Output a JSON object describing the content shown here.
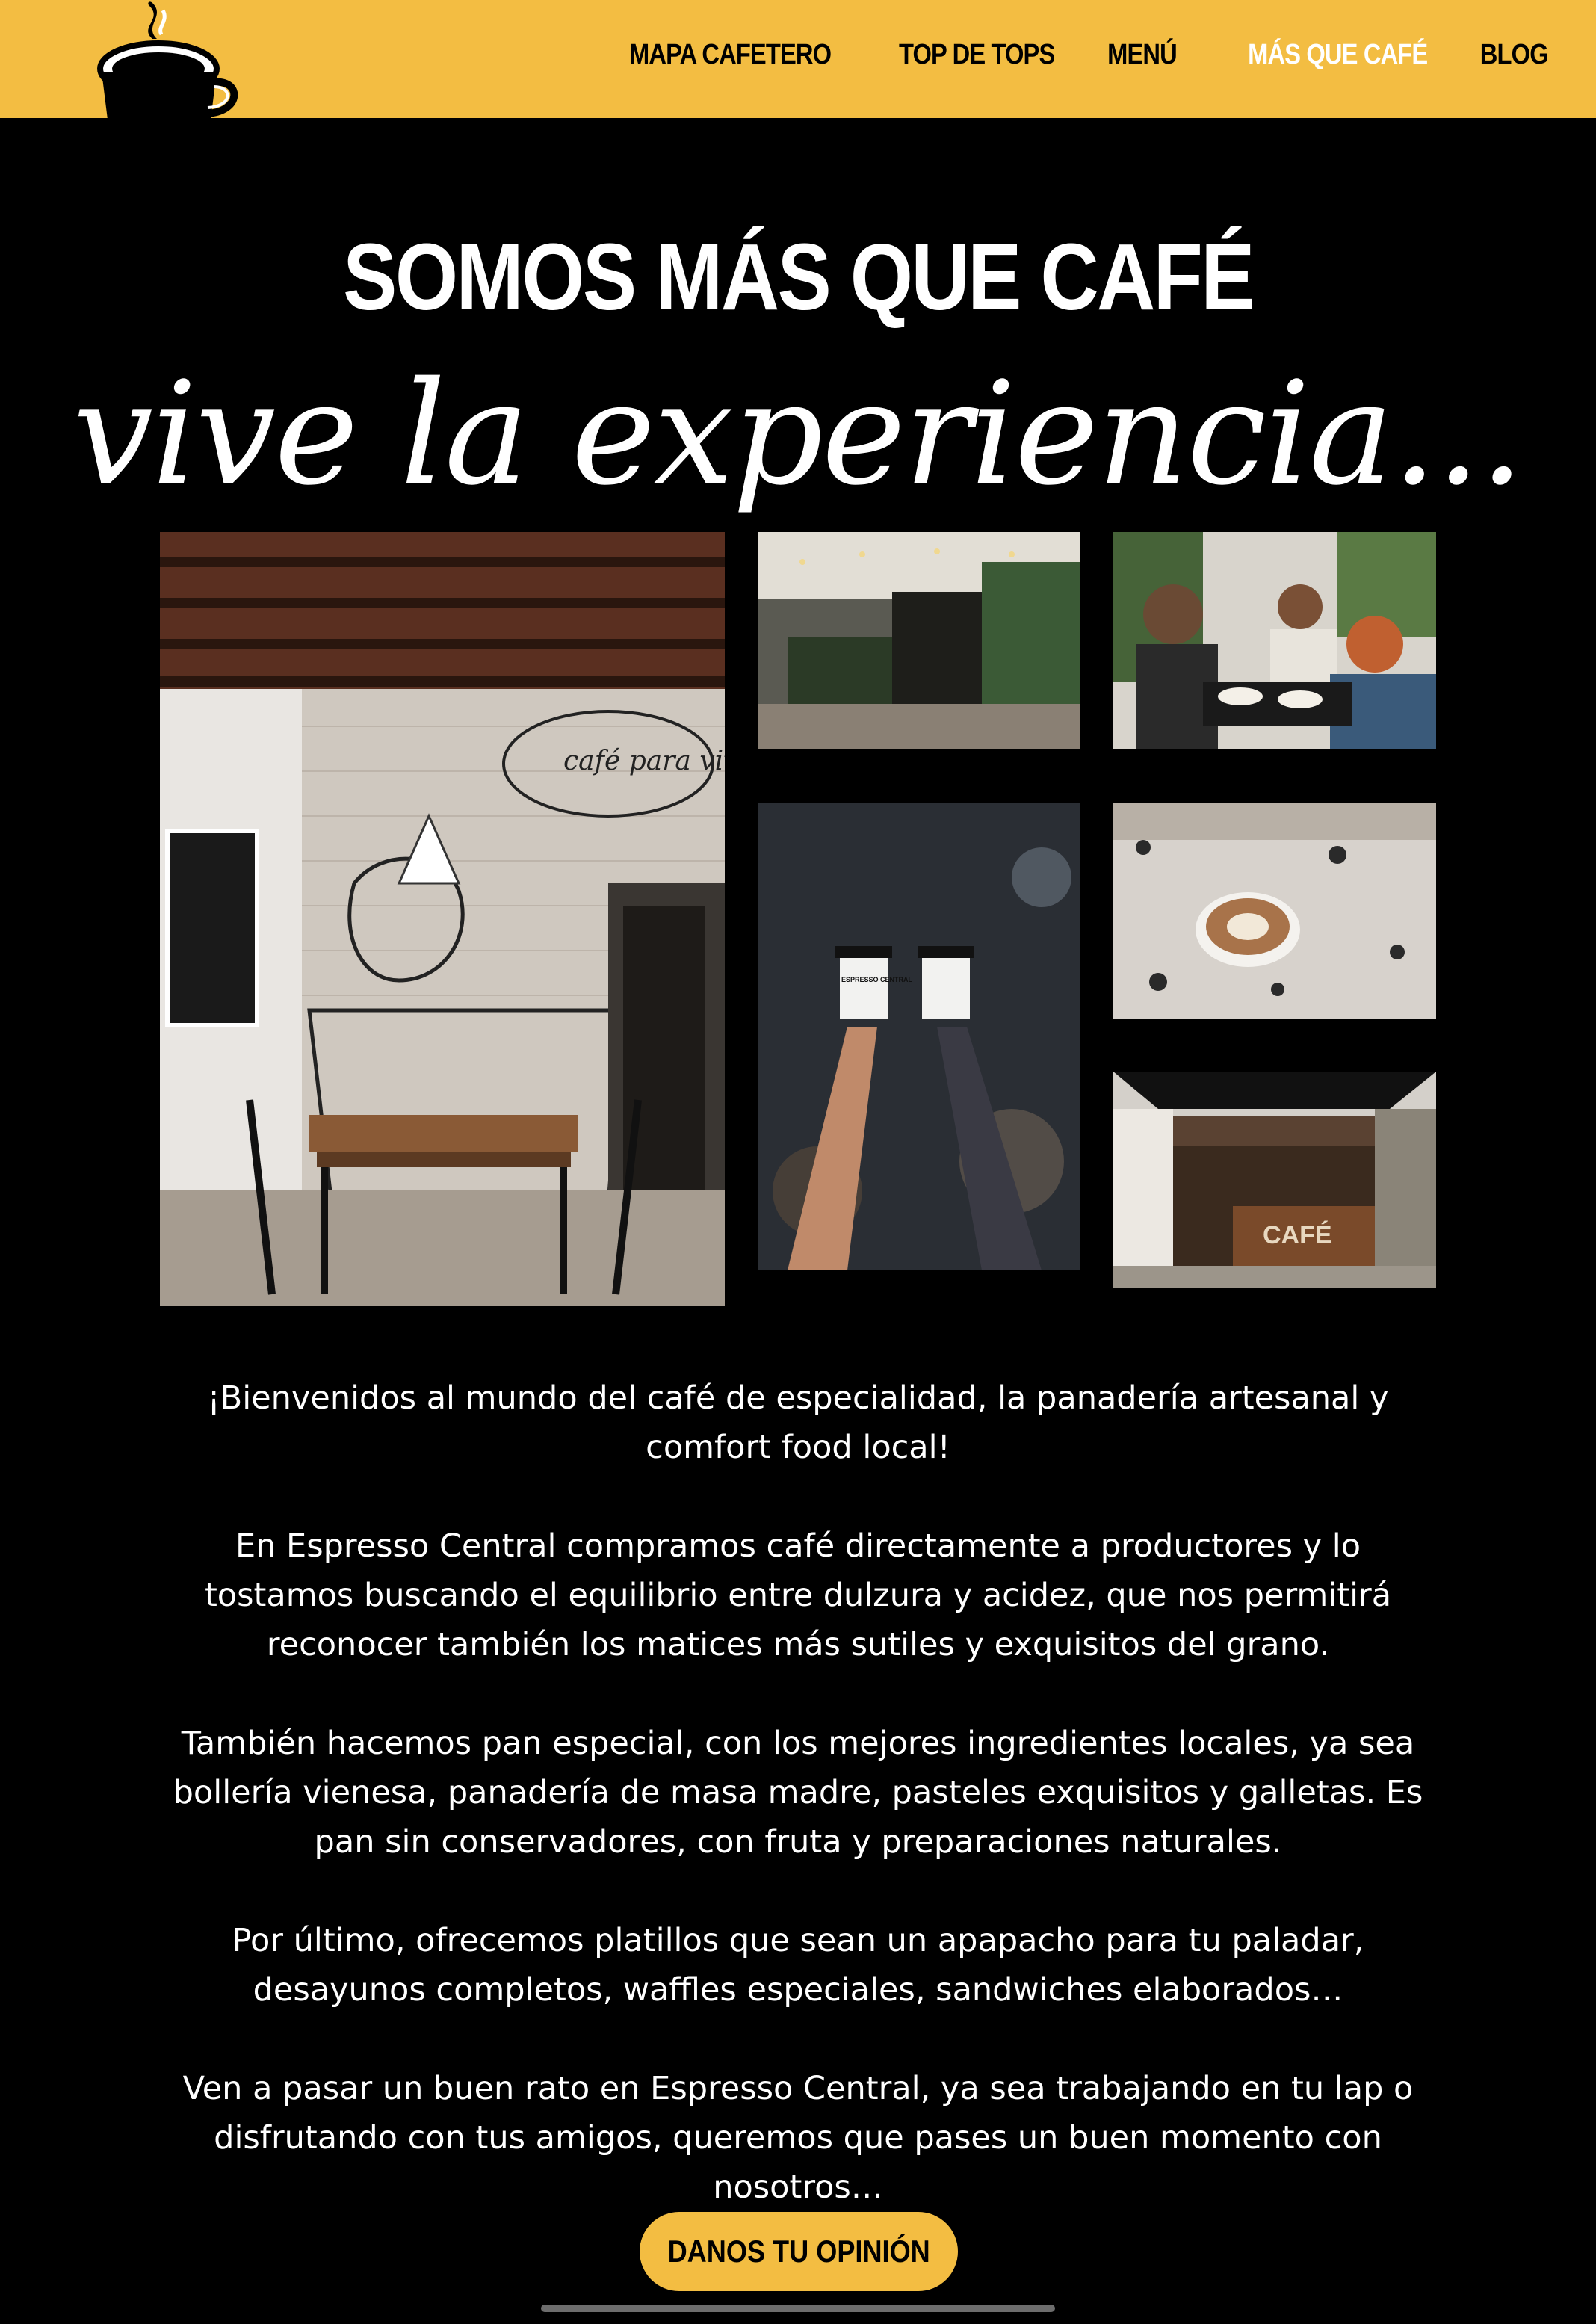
{
  "nav": {
    "items": [
      {
        "label": "MAPA CAFETERO"
      },
      {
        "label": "TOP DE TOPS"
      },
      {
        "label": "MENÚ"
      },
      {
        "label": "MÁS QUE CAFÉ"
      },
      {
        "label": "BLOG"
      }
    ],
    "active_label": "MÁS QUE CAFÉ"
  },
  "hero": {
    "title": "SOMOS MÁS QUE CAFÉ",
    "subtitle": "vive la experiencia..."
  },
  "gallery": {
    "mural_text": "café para vivir",
    "cup_text": "ESPRESSO CENTRAL",
    "storefront_sign": "CAFÉ"
  },
  "intro": {
    "paragraphs": [
      "¡Bienvenidos al mundo del café de especialidad, la panadería artesanal y comfort food local!",
      "En Espresso Central compramos café directamente a productores y lo tostamos buscando el equilibrio entre dulzura y acidez, que nos permitirá reconocer también los matices más sutiles y exquisitos del grano.",
      "También hacemos pan especial, con los mejores ingredientes locales, ya sea bollería vienesa, panadería de masa madre, pasteles exquisitos y galletas. Es pan sin conservadores, con fruta y preparaciones naturales.",
      "Por último, ofrecemos platillos que sean un apapacho para tu paladar, desayunos completos, waffles especiales, sandwiches elaborados…",
      "Ven a pasar un buen rato en Espresso Central, ya sea trabajando en tu lap o disfrutando con tus amigos, queremos que pases un buen momento con nosotros…"
    ]
  },
  "cta": {
    "label": "DANOS TU OPINIÓN"
  },
  "colors": {
    "brand_yellow": "#f3bd42",
    "background": "#000000",
    "text": "#ffffff"
  },
  "icons": {
    "logo": "coffee-cup-logo-icon"
  }
}
